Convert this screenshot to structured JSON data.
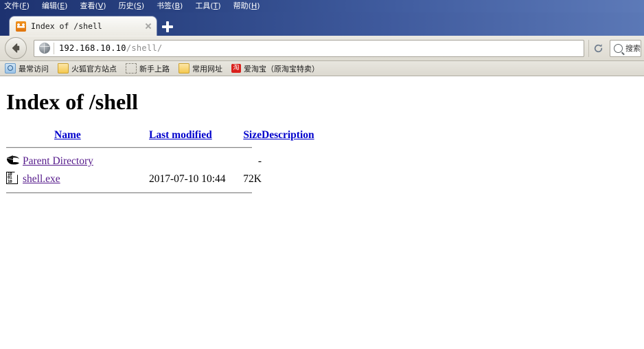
{
  "menubar": {
    "items": [
      {
        "label": "文件",
        "accel": "F"
      },
      {
        "label": "编辑",
        "accel": "E"
      },
      {
        "label": "查看",
        "accel": "V"
      },
      {
        "label": "历史",
        "accel": "S"
      },
      {
        "label": "书签",
        "accel": "B"
      },
      {
        "label": "工具",
        "accel": "T"
      },
      {
        "label": "帮助",
        "accel": "H"
      }
    ]
  },
  "tabstrip": {
    "tab": {
      "title": "Index of /shell",
      "favicon": "firefox-favicon",
      "close_label": "×"
    },
    "newtab_label": "+"
  },
  "navbar": {
    "back_icon": "back-arrow-icon",
    "site_icon": "globe-icon",
    "url_host": "192.168.10.10",
    "url_path": "/shell/",
    "reload_icon": "reload-icon",
    "search_icon": "search-icon",
    "search_placeholder": "搜索"
  },
  "bookmarks": {
    "items": [
      {
        "label": "最常访问",
        "icon": "most-visited-icon"
      },
      {
        "label": "火狐官方站点",
        "icon": "folder-icon"
      },
      {
        "label": "新手上路",
        "icon": "dashed-folder-icon"
      },
      {
        "label": "常用网址",
        "icon": "folder-icon"
      },
      {
        "label": "爱淘宝（原淘宝特卖）",
        "icon": "taobao-icon",
        "icon_text": "淘"
      }
    ]
  },
  "page": {
    "title": "Index of /shell",
    "headers": {
      "name": "Name",
      "last_modified": "Last modified",
      "size": "Size",
      "description": "Description"
    },
    "rows": [
      {
        "icon": "parent-directory-icon",
        "name": "Parent Directory",
        "last_modified": "",
        "size": "-",
        "description": ""
      },
      {
        "icon": "binary-file-icon",
        "name": "shell.exe",
        "last_modified": "2017-07-10 10:44",
        "size": "72K",
        "description": ""
      }
    ]
  }
}
